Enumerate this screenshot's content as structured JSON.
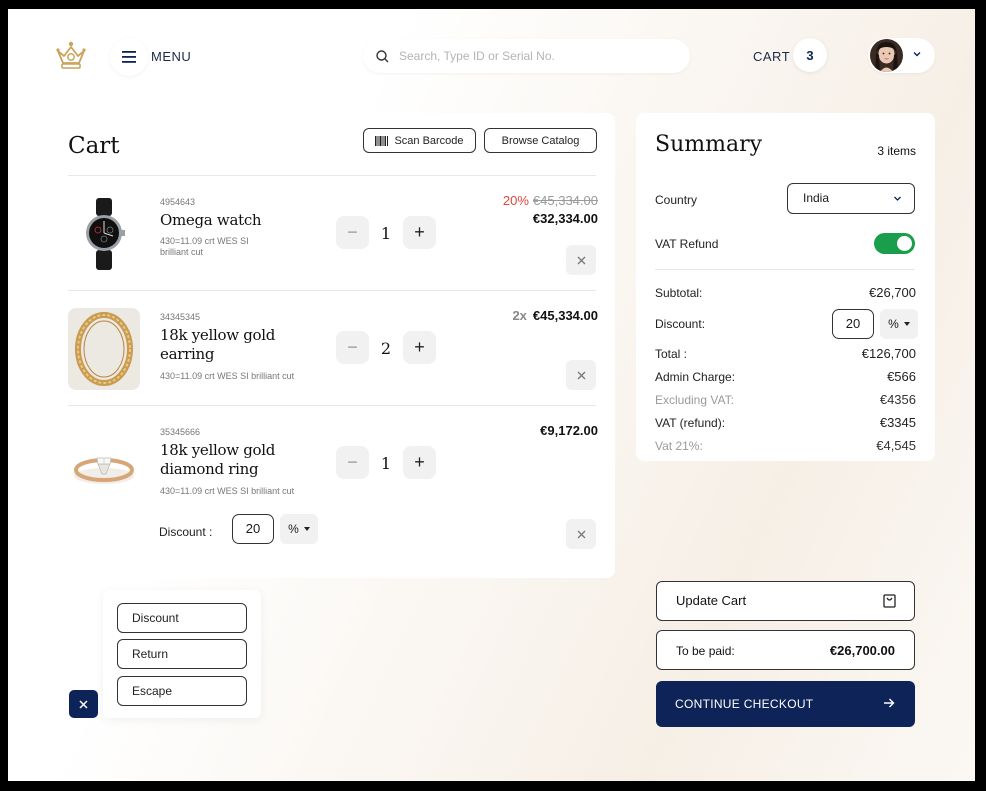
{
  "header": {
    "menu_label": "MENU",
    "search_placeholder": "Search, Type ID or Serial No.",
    "cart_label": "CART",
    "cart_count": "3"
  },
  "cart": {
    "title": "Cart",
    "scan_label": "Scan Barcode",
    "browse_label": "Browse Catalog",
    "items": [
      {
        "id": "4954643",
        "name": "Omega watch",
        "desc_line1": "430=11.09 crt WES SI",
        "desc_line2": "brilliant cut",
        "qty": "1",
        "discount_pct": "20%",
        "old_price": "€45,334.00",
        "price": "€32,334.00"
      },
      {
        "id": "34345345",
        "name_line1": "18k yellow gold",
        "name_line2": "earring",
        "desc": "430=11.09 crt WES SI brilliant cut",
        "qty": "2",
        "multiplier": "2x",
        "price": "€45,334.00"
      },
      {
        "id": "35345666",
        "name_line1": "18k yellow gold",
        "name_line2": "diamond ring",
        "desc": "430=11.09 crt WES SI brilliant cut",
        "qty": "1",
        "price": "€9,172.00",
        "discount_label": "Discount :",
        "discount_value": "20",
        "discount_unit": "%"
      }
    ]
  },
  "popup": {
    "options": [
      "Discount",
      "Return",
      "Escape"
    ]
  },
  "summary": {
    "title": "Summary",
    "items_count": "3 items",
    "country_label": "Country",
    "country_value": "India",
    "vat_refund_label": "VAT Refund",
    "vat_refund_on": true,
    "subtotal_label": "Subtotal:",
    "subtotal_value": "€26,700",
    "discount_label": "Discount:",
    "discount_value": "20",
    "discount_unit": "%",
    "total_label": "Total :",
    "total_value": "€126,700",
    "admin_label": "Admin Charge:",
    "admin_value": "€566",
    "excl_vat_label": "Excluding VAT:",
    "excl_vat_value": "€4356",
    "vat_refund_row_label": "VAT (refund):",
    "vat_refund_row_value": "€3345",
    "vat21_label": "Vat 21%:",
    "vat21_value": "€4,545"
  },
  "actions": {
    "update_cart": "Update Cart",
    "to_be_paid_label": "To be paid:",
    "to_be_paid_value": "€26,700.00",
    "checkout": "CONTINUE CHECKOUT"
  },
  "colors": {
    "navy": "#0e2357",
    "toggle_green": "#1b9e4b",
    "discount_red": "#e0453b",
    "gold": "#c9a45c"
  },
  "icons": [
    "crown-logo-icon",
    "hamburger-menu-icon",
    "search-icon",
    "chevron-down-icon",
    "barcode-icon",
    "close-icon",
    "bag-icon",
    "arrow-right-icon"
  ]
}
